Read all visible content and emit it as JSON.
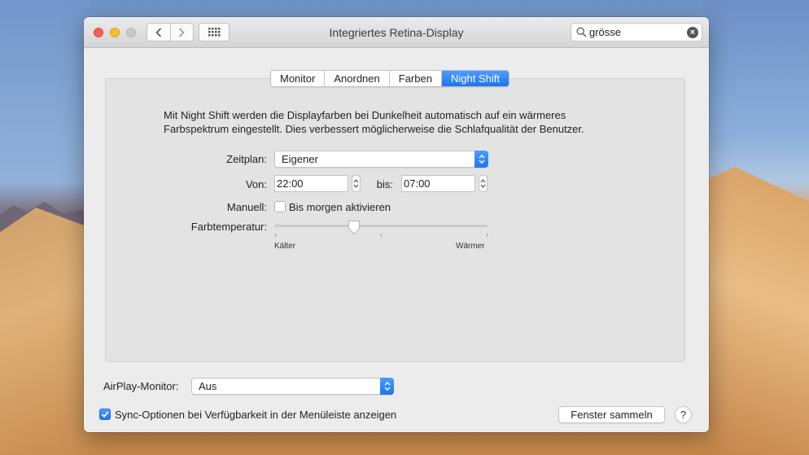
{
  "window": {
    "title": "Integriertes Retina-Display",
    "search_value": "grösse"
  },
  "tabs": [
    {
      "label": "Monitor",
      "active": false
    },
    {
      "label": "Anordnen",
      "active": false
    },
    {
      "label": "Farben",
      "active": false
    },
    {
      "label": "Night Shift",
      "active": true
    }
  ],
  "night_shift": {
    "description": "Mit Night Shift werden die Displayfarben bei Dunkelheit automatisch auf ein wärmeres Farbspektrum eingestellt. Dies verbessert möglicherweise die Schlafqualität der Benutzer.",
    "schedule_label": "Zeitplan:",
    "schedule_value": "Eigener",
    "from_label": "Von:",
    "from_value": "22:00",
    "to_label": "bis:",
    "to_value": "07:00",
    "manual_label": "Manuell:",
    "manual_checkbox_label": "Bis morgen aktivieren",
    "manual_checked": false,
    "temperature_label": "Farbtemperatur:",
    "temperature_level_fraction": 0.37,
    "cooler_label": "Kälter",
    "warmer_label": "Wärmer"
  },
  "footer": {
    "airplay_label": "AirPlay-Monitor:",
    "airplay_value": "Aus",
    "sync_label": "Sync-Optionen bei Verfügbarkeit in der Menüleiste anzeigen",
    "sync_checked": true,
    "gather_button": "Fenster sammeln",
    "help_button": "?"
  },
  "colors": {
    "accent": "#1d75f0",
    "close": "#fc5f57",
    "minimize": "#fdbc2e",
    "zoom_disabled": "#c9c9c9"
  }
}
